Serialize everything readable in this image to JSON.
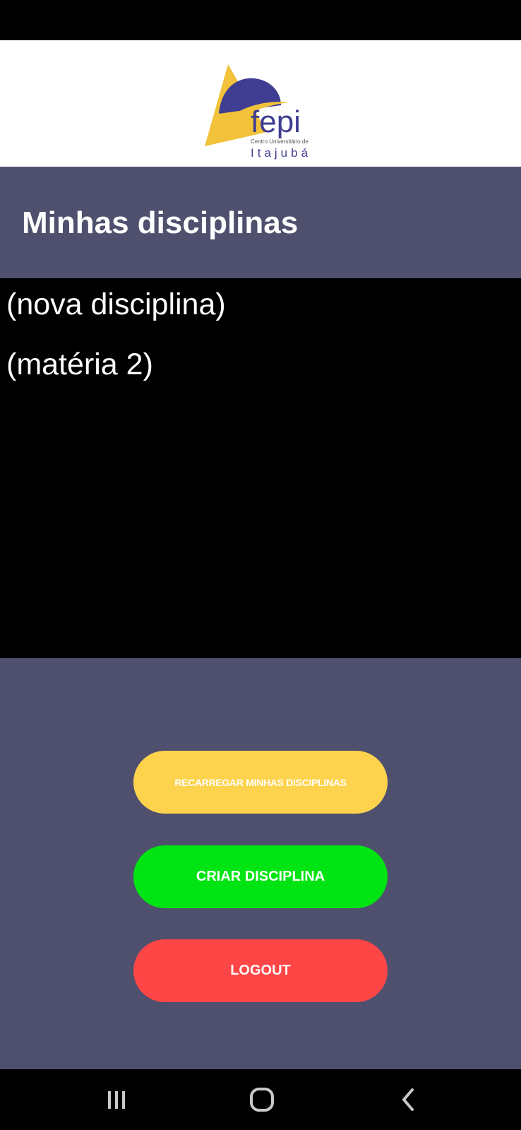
{
  "header": {
    "title": "Minhas disciplinas"
  },
  "logo": {
    "name": "fepi",
    "tagline": "Centro Universitário de",
    "city": "Itajubá"
  },
  "disciplines": [
    {
      "name": "(nova disciplina)"
    },
    {
      "name": "(matéria 2)"
    }
  ],
  "actions": {
    "reload_label": "RECARREGAR MINHAS DISCIPLINAS",
    "create_label": "CRIAR DISCIPLINA",
    "logout_label": "LOGOUT"
  },
  "navigation": {
    "recents_icon": "recents-icon",
    "home_icon": "home-icon",
    "back_icon": "back-icon"
  },
  "colors": {
    "header_bg": "#4f506e",
    "list_bg": "#000000",
    "reload_button": "#fdd34d",
    "create_button": "#00e413",
    "logout_button": "#ff4646",
    "logo_yellow": "#f1c23a",
    "logo_blue": "#3f3e92"
  }
}
